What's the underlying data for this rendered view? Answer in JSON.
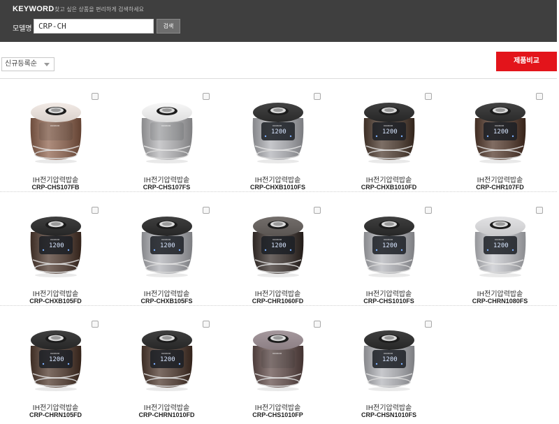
{
  "search": {
    "title": "KEYWORD",
    "description": "찾고 싶은 상품을 편리하게 검색하세요",
    "model_label": "모델명",
    "input_value": "CRP-CH",
    "button_label": "검색"
  },
  "toolbar": {
    "sort_selected": "신규등록순",
    "compare_label": "제품비교"
  },
  "products": [
    {
      "category": "IH전기압력밥솥",
      "model": "CRP-CHS107FB",
      "body_color": "#8b6a5a",
      "lid_color": "#d9d1cc",
      "lcd": false
    },
    {
      "category": "IH전기압력밥솥",
      "model": "CRP-CHS107FS",
      "body_color": "#a7a7a9",
      "lid_color": "#dedede",
      "lcd": false
    },
    {
      "category": "IH전기압력밥솥",
      "model": "CRP-CHXB1010FS",
      "body_color": "#a3a4a8",
      "lid_color": "#2a2a2a",
      "lcd": true
    },
    {
      "category": "IH전기압력밥솥",
      "model": "CRP-CHXB1010FD",
      "body_color": "#5a4c43",
      "lid_color": "#262626",
      "lcd": true
    },
    {
      "category": "IH전기압력밥솥",
      "model": "CRP-CHR107FD",
      "body_color": "#5e4a40",
      "lid_color": "#2a2a2a",
      "lcd": true
    },
    {
      "category": "IH전기압력밥솥",
      "model": "CRP-CHXB105FD",
      "body_color": "#5a4a42",
      "lid_color": "#262626",
      "lcd": true
    },
    {
      "category": "IH전기압력밥솥",
      "model": "CRP-CHXB105FS",
      "body_color": "#a4a5a9",
      "lid_color": "#262626",
      "lcd": true
    },
    {
      "category": "IH전기압력밥솥",
      "model": "CRP-CHR1060FD",
      "body_color": "#4a4340",
      "lid_color": "#5a5552",
      "lcd": true
    },
    {
      "category": "IH전기압력밥솥",
      "model": "CRP-CHS1010FS",
      "body_color": "#a6a7ab",
      "lid_color": "#262626",
      "lcd": true
    },
    {
      "category": "IH전기압력밥솥",
      "model": "CRP-CHRN1080FS",
      "body_color": "#b3b4b8",
      "lid_color": "#c9c9cb",
      "lcd": true
    },
    {
      "category": "IH전기압력밥솥",
      "model": "CRP-CHRN105FD",
      "body_color": "#5b4a41",
      "lid_color": "#262626",
      "lcd": true
    },
    {
      "category": "IH전기압력밥솥",
      "model": "CRP-CHRN1010FD",
      "body_color": "#5a4a42",
      "lid_color": "#262626",
      "lcd": true
    },
    {
      "category": "IH전기압력밥솥",
      "model": "CRP-CHS1010FP",
      "body_color": "#6a5a58",
      "lid_color": "#8c7f84",
      "lcd": false
    },
    {
      "category": "IH전기압력밥솥",
      "model": "CRP-CHSN1010FS",
      "body_color": "#a5a6aa",
      "lid_color": "#262626",
      "lcd": true
    }
  ],
  "colors": {
    "header_bg": "#3f3f3f",
    "compare_button": "#e3141b"
  }
}
